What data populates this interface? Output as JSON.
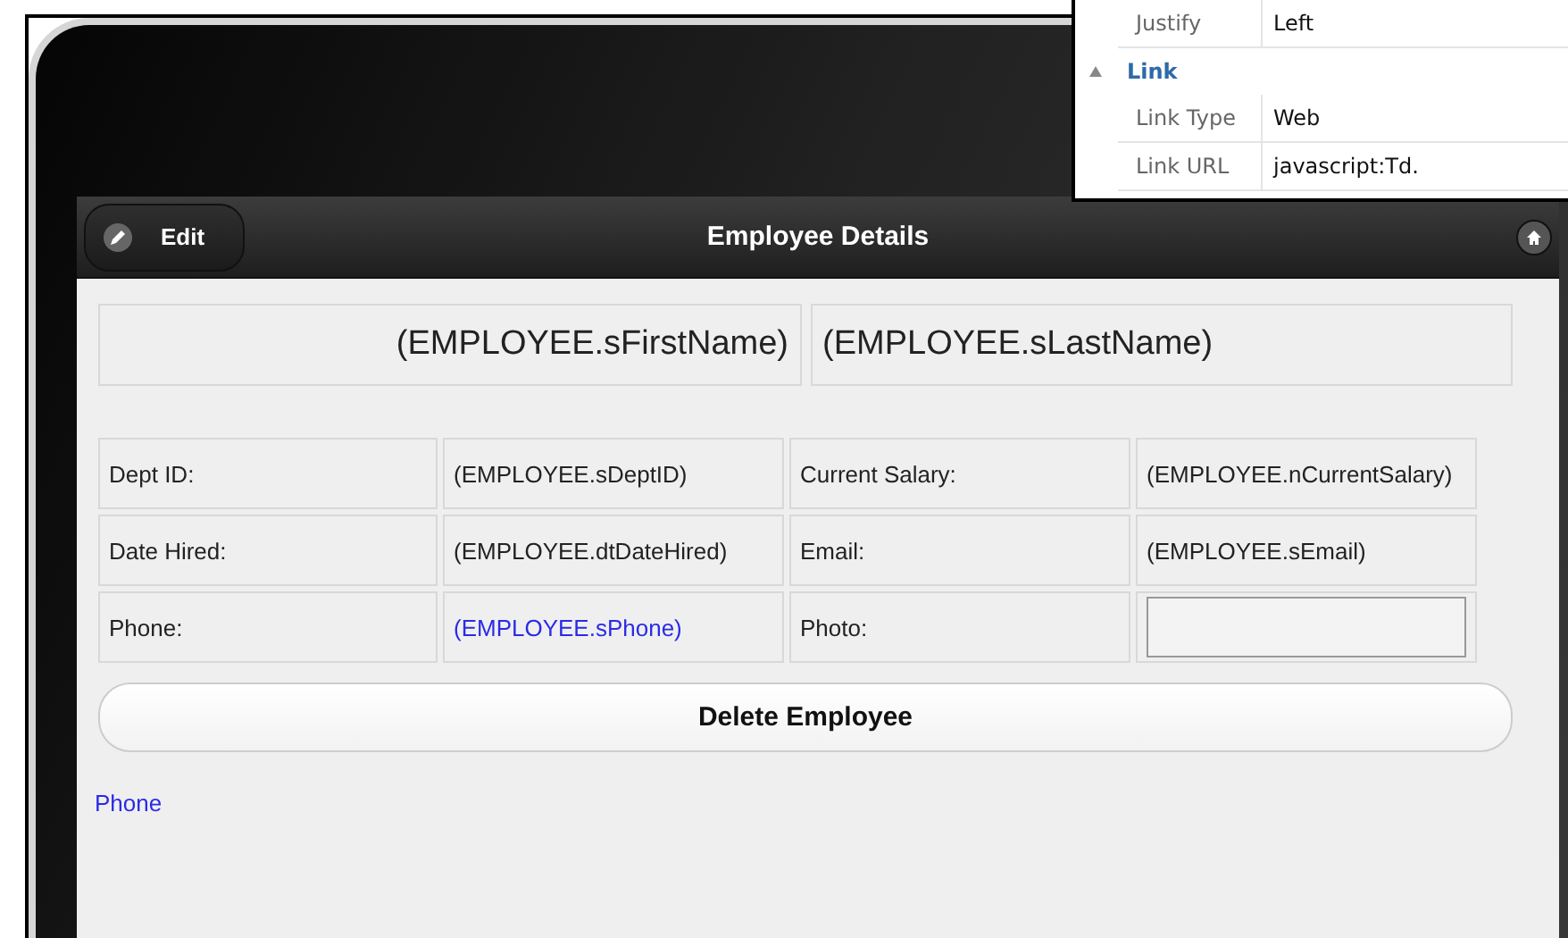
{
  "properties_panel": {
    "rows": [
      {
        "kind": "property",
        "label": "Justify",
        "value": "Left"
      },
      {
        "kind": "group",
        "label": "Link",
        "expanded": true
      },
      {
        "kind": "property",
        "label": "Link Type",
        "value": "Web"
      },
      {
        "kind": "property",
        "label": "Link URL",
        "value": "javascript:Td."
      }
    ]
  },
  "header": {
    "edit_button": "Edit",
    "title": "Employee Details"
  },
  "name_fields": [
    "(EMPLOYEE.sFirstName)",
    "(EMPLOYEE.sLastName)"
  ],
  "details": [
    [
      {
        "kind": "label",
        "text": "Dept ID:"
      },
      {
        "kind": "value",
        "text": "(EMPLOYEE.sDeptID)"
      },
      {
        "kind": "label",
        "text": "Current Salary:"
      },
      {
        "kind": "value",
        "text": "(EMPLOYEE.nCurrentSalary)"
      }
    ],
    [
      {
        "kind": "label",
        "text": "Date Hired:"
      },
      {
        "kind": "value",
        "text": "(EMPLOYEE.dtDateHired)"
      },
      {
        "kind": "label",
        "text": "Email:"
      },
      {
        "kind": "value",
        "text": "(EMPLOYEE.sEmail)"
      }
    ],
    [
      {
        "kind": "label",
        "text": "Phone:"
      },
      {
        "kind": "link",
        "text": "(EMPLOYEE.sPhone)"
      },
      {
        "kind": "label",
        "text": "Photo:"
      },
      {
        "kind": "image"
      }
    ]
  ],
  "delete_button": "Delete Employee",
  "footer_link": "Phone"
}
